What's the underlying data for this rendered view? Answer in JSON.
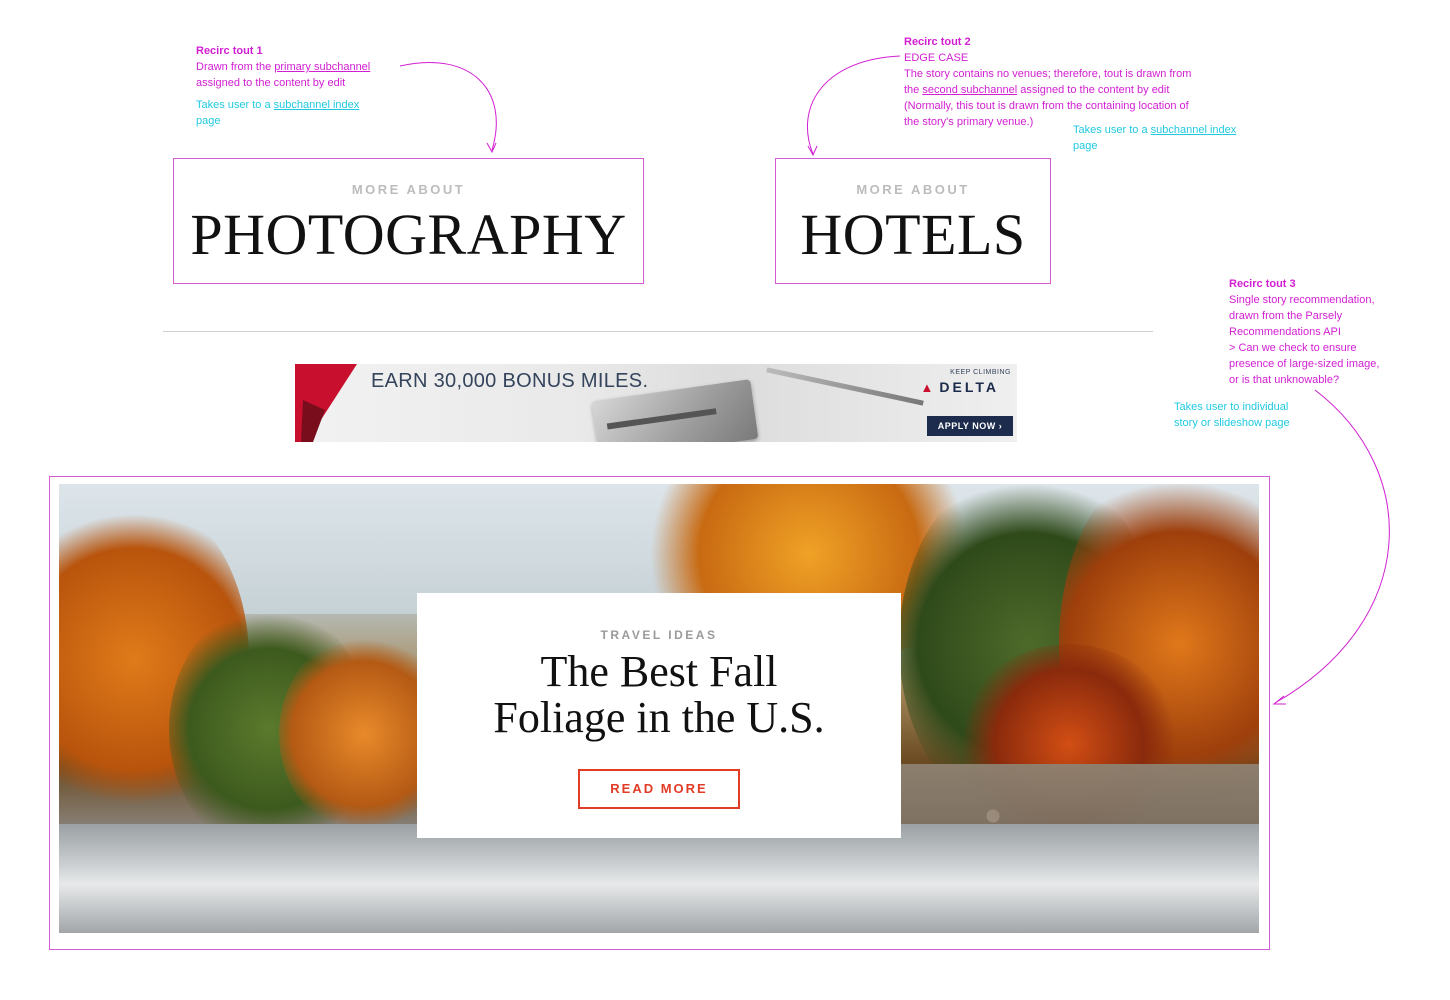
{
  "colors": {
    "annotation": "#d21ed2",
    "link_note": "#20c9e0",
    "tout_border": "#d55ad6",
    "cta": "#e23b26"
  },
  "note1": {
    "title": "Recirc tout 1",
    "line1_a": "Drawn from the ",
    "line1_link": "primary subchannel",
    "line2": "assigned to the content by edit",
    "cyan_a": "Takes user to a ",
    "cyan_link": "subchannel index",
    "cyan_b": "page"
  },
  "note2": {
    "title": "Recirc tout 2",
    "sub": "EDGE CASE",
    "line1": "The story contains no venues; therefore, tout is drawn from",
    "line2_a": "the ",
    "line2_link": "second subchannel",
    "line2_b": " assigned to the content by edit",
    "line3": "(Normally, this tout is drawn from the containing location of",
    "line4": "the story's primary venue.)",
    "cyan_a": "Takes user to a ",
    "cyan_link": "subchannel index",
    "cyan_b": "page"
  },
  "note3": {
    "title": "Recirc tout 3",
    "l1": "Single story recommendation,",
    "l2": "drawn from the Parsely",
    "l3": "Recommendations API",
    "l4": "> Can we check to ensure",
    "l5": "presence of large-sized image,",
    "l6": "or is that unknowable?",
    "cyan1": "Takes user to individual",
    "cyan2": "story or slideshow page"
  },
  "tout1": {
    "eyebrow": "MORE ABOUT",
    "label": "PHOTOGRAPHY"
  },
  "tout2": {
    "eyebrow": "MORE ABOUT",
    "label": "HOTELS"
  },
  "ad": {
    "headline": "EARN 30,000 BONUS MILES.",
    "tagline": "KEEP CLIMBING",
    "brand": "DELTA",
    "cta": "APPLY NOW ›"
  },
  "hero": {
    "eyebrow": "TRAVEL IDEAS",
    "title_line1": "The Best Fall",
    "title_line2": "Foliage in the U.S.",
    "cta": "READ MORE"
  }
}
